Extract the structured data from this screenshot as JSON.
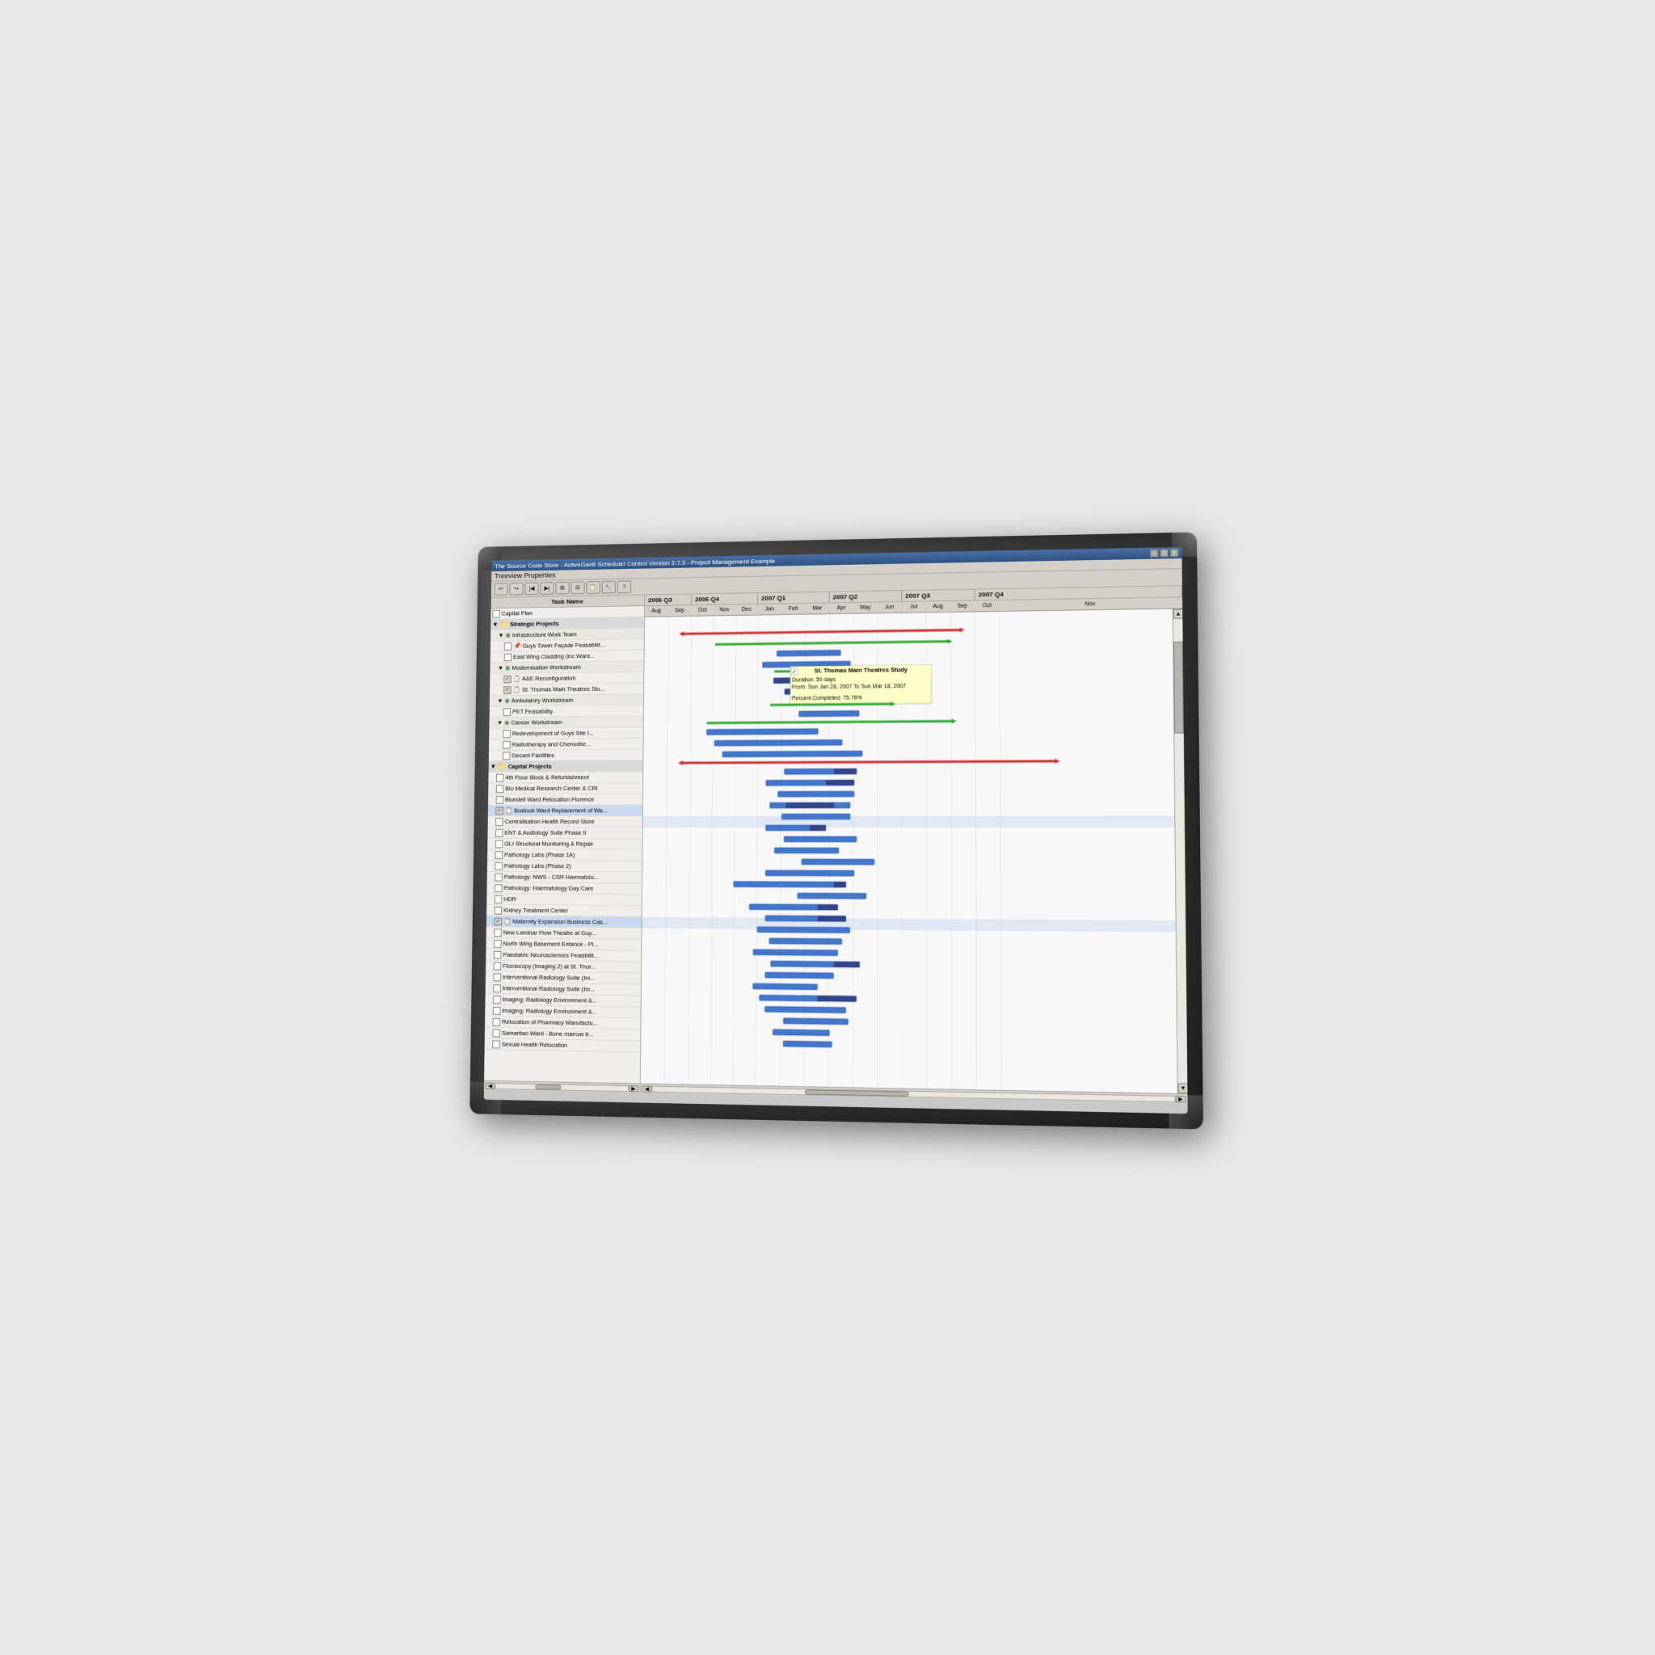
{
  "window": {
    "title": "The Source Code Store - ActiveGantt Scheduler Control Version 2.7.3 - Project Management Example",
    "menu_items": [
      "Treeview Properties"
    ],
    "win_controls": [
      "-",
      "□",
      "×"
    ]
  },
  "toolbar": {
    "buttons": [
      "↩",
      "↪",
      "◀",
      "▶",
      "📋",
      "🔧",
      "📊",
      "?"
    ]
  },
  "gantt": {
    "task_column_header": "Task Name",
    "years": [
      {
        "label": "2006 Q3",
        "width": 90
      },
      {
        "label": "2006 Q4",
        "width": 90
      },
      {
        "label": "2007 Q1",
        "width": 90
      },
      {
        "label": "2007 Q2",
        "width": 90
      },
      {
        "label": "2007 Q3",
        "width": 90
      },
      {
        "label": "2007 Q4",
        "width": 60
      }
    ],
    "months": [
      "Aug",
      "Sep",
      "Oct",
      "Nov",
      "Dec",
      "Jan",
      "Feb",
      "Mar",
      "Apr",
      "May",
      "Jun",
      "Jul",
      "Aug",
      "Sep",
      "Oct",
      "Nov"
    ],
    "tooltip": {
      "title": "St. Thomas Main Theatres Study",
      "duration": "Duration: 50 days",
      "from_to": "From: Sun Jan 28, 2007 To Sun Mar 18, 2007",
      "percent": "Percent Completed: 75.76%"
    },
    "tasks": [
      {
        "id": 1,
        "label": "Capital Plan",
        "indent": 0,
        "check": false,
        "icon": false,
        "highlighted": false,
        "group": false
      },
      {
        "id": 2,
        "label": "Strategic Projects",
        "indent": 0,
        "check": false,
        "icon": false,
        "highlighted": false,
        "group": true
      },
      {
        "id": 3,
        "label": "Infrastructure Work Team",
        "indent": 1,
        "check": false,
        "icon": true,
        "highlighted": false,
        "group": true,
        "subgroup": true
      },
      {
        "id": 4,
        "label": "Guys Tower Façade Feasabilit...",
        "indent": 2,
        "check": false,
        "icon": true,
        "highlighted": false,
        "group": false
      },
      {
        "id": 5,
        "label": "East Wing Cladding (inc Ward...",
        "indent": 2,
        "check": false,
        "icon": false,
        "highlighted": false,
        "group": false
      },
      {
        "id": 6,
        "label": "Modernisation Workstream",
        "indent": 1,
        "check": false,
        "icon": true,
        "highlighted": false,
        "group": true,
        "subgroup": true
      },
      {
        "id": 7,
        "label": "A&E Reconfiguration",
        "indent": 2,
        "check": true,
        "icon": true,
        "highlighted": false,
        "group": false
      },
      {
        "id": 8,
        "label": "St. Thomas Main Theatres Stu...",
        "indent": 2,
        "check": true,
        "icon": true,
        "highlighted": false,
        "group": false
      },
      {
        "id": 9,
        "label": "Ambulatory Workstream",
        "indent": 1,
        "check": false,
        "icon": true,
        "highlighted": false,
        "group": true,
        "subgroup": true
      },
      {
        "id": 10,
        "label": "PET Feasability",
        "indent": 2,
        "check": false,
        "icon": false,
        "highlighted": false,
        "group": false
      },
      {
        "id": 11,
        "label": "Cancer Workstream",
        "indent": 1,
        "check": false,
        "icon": true,
        "highlighted": false,
        "group": true,
        "subgroup": true
      },
      {
        "id": 12,
        "label": "Redevelopment of Guys Site I...",
        "indent": 2,
        "check": false,
        "icon": false,
        "highlighted": false,
        "group": false
      },
      {
        "id": 13,
        "label": "Radiotherapy and Chemothe...",
        "indent": 2,
        "check": false,
        "icon": false,
        "highlighted": false,
        "group": false
      },
      {
        "id": 14,
        "label": "Decant Facilities",
        "indent": 2,
        "check": false,
        "icon": false,
        "highlighted": false,
        "group": false
      },
      {
        "id": 15,
        "label": "Capital Projects",
        "indent": 0,
        "check": false,
        "icon": false,
        "highlighted": false,
        "group": true
      },
      {
        "id": 16,
        "label": "4th Floor Block & Refurbishment",
        "indent": 1,
        "check": false,
        "icon": false,
        "highlighted": false,
        "group": false
      },
      {
        "id": 17,
        "label": "Bio Medical Research Center & CRI",
        "indent": 1,
        "check": false,
        "icon": false,
        "highlighted": false,
        "group": false
      },
      {
        "id": 18,
        "label": "Blundell Ward Relocation Florence",
        "indent": 1,
        "check": false,
        "icon": false,
        "highlighted": false,
        "group": false
      },
      {
        "id": 19,
        "label": "Bostock Ward Replacement of Wa...",
        "indent": 1,
        "check": true,
        "icon": true,
        "highlighted": true,
        "group": false
      },
      {
        "id": 20,
        "label": "Centralisation Health Record Store",
        "indent": 1,
        "check": false,
        "icon": false,
        "highlighted": false,
        "group": false
      },
      {
        "id": 21,
        "label": "ENT & Audiology Suite Phase II",
        "indent": 1,
        "check": false,
        "icon": false,
        "highlighted": false,
        "group": false
      },
      {
        "id": 22,
        "label": "GLI Structural Monitoring & Repair",
        "indent": 1,
        "check": false,
        "icon": false,
        "highlighted": false,
        "group": false
      },
      {
        "id": 23,
        "label": "Pathology Labs (Phase 1A)",
        "indent": 1,
        "check": false,
        "icon": false,
        "highlighted": false,
        "group": false
      },
      {
        "id": 24,
        "label": "Pathology Labs (Phase 2)",
        "indent": 1,
        "check": false,
        "icon": false,
        "highlighted": false,
        "group": false
      },
      {
        "id": 25,
        "label": "Pathology: NWS - CSR Haematolo...",
        "indent": 1,
        "check": false,
        "icon": false,
        "highlighted": false,
        "group": false
      },
      {
        "id": 26,
        "label": "Pathology: Haematology Day Care",
        "indent": 1,
        "check": false,
        "icon": false,
        "highlighted": false,
        "group": false
      },
      {
        "id": 27,
        "label": "HDR",
        "indent": 1,
        "check": false,
        "icon": false,
        "highlighted": false,
        "group": false
      },
      {
        "id": 28,
        "label": "Kidney Treatment Center",
        "indent": 1,
        "check": false,
        "icon": false,
        "highlighted": false,
        "group": false
      },
      {
        "id": 29,
        "label": "Maternity Expansion Business Cas...",
        "indent": 1,
        "check": true,
        "icon": true,
        "highlighted": true,
        "group": false
      },
      {
        "id": 30,
        "label": "New Laminar Flow Theatre at Guy...",
        "indent": 1,
        "check": false,
        "icon": false,
        "highlighted": false,
        "group": false
      },
      {
        "id": 31,
        "label": "North Wing Basement Entance - PI...",
        "indent": 1,
        "check": false,
        "icon": false,
        "highlighted": false,
        "group": false
      },
      {
        "id": 32,
        "label": "Paediatric Neurosciences Feasibilit...",
        "indent": 1,
        "check": false,
        "icon": false,
        "highlighted": false,
        "group": false
      },
      {
        "id": 33,
        "label": "Fluroscopy (Imaging 2) at St. Thor...",
        "indent": 1,
        "check": false,
        "icon": false,
        "highlighted": false,
        "group": false
      },
      {
        "id": 34,
        "label": "Interventional Radiology Suite (Im...",
        "indent": 1,
        "check": false,
        "icon": false,
        "highlighted": false,
        "group": false
      },
      {
        "id": 35,
        "label": "Interventional Radiology Suite (Im...",
        "indent": 1,
        "check": false,
        "icon": false,
        "highlighted": false,
        "group": false
      },
      {
        "id": 36,
        "label": "Imaging: Radiology Environment &...",
        "indent": 1,
        "check": false,
        "icon": false,
        "highlighted": false,
        "group": false
      },
      {
        "id": 37,
        "label": "Imaging: Radiology Environment &...",
        "indent": 1,
        "check": false,
        "icon": false,
        "highlighted": false,
        "group": false
      },
      {
        "id": 38,
        "label": "Relocation of Pharmacy Manufactu...",
        "indent": 1,
        "check": false,
        "icon": false,
        "highlighted": false,
        "group": false
      },
      {
        "id": 39,
        "label": "Samaritan Ward - Bone marrow tr...",
        "indent": 1,
        "check": false,
        "icon": false,
        "highlighted": false,
        "group": false
      },
      {
        "id": 40,
        "label": "Sexual Health Relocation",
        "indent": 1,
        "check": false,
        "icon": false,
        "highlighted": false,
        "group": false
      }
    ]
  }
}
